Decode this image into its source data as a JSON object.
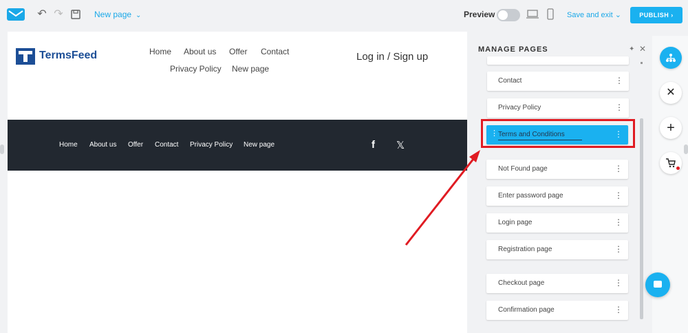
{
  "topbar": {
    "page_name": "New page",
    "preview_label": "Preview",
    "save_exit_label": "Save and exit",
    "publish_label": "PUBLISH"
  },
  "site": {
    "brand_name": "TermsFeed",
    "header_nav": [
      "Home",
      "About us",
      "Offer",
      "Contact",
      "Privacy Policy",
      "New page"
    ],
    "auth_label": "Log in / Sign up",
    "footer_nav": [
      "Home",
      "About us",
      "Offer",
      "Contact",
      "Privacy Policy",
      "New page"
    ]
  },
  "panel": {
    "title": "MANAGE PAGES",
    "pages": [
      "Contact",
      "Privacy Policy",
      "Terms and Conditions",
      "Not Found page",
      "Enter password page",
      "Login page",
      "Registration page",
      "Checkout page",
      "Confirmation page"
    ],
    "selected": "Terms and Conditions"
  },
  "colors": {
    "accent": "#1ab1f0",
    "footer_bg": "#222830",
    "brand": "#1c4e96",
    "highlight": "#e01b22"
  },
  "icons": {
    "rail": [
      "sitemap-icon",
      "close-icon",
      "plus-icon",
      "cart-icon"
    ],
    "chat": "chat-icon"
  }
}
